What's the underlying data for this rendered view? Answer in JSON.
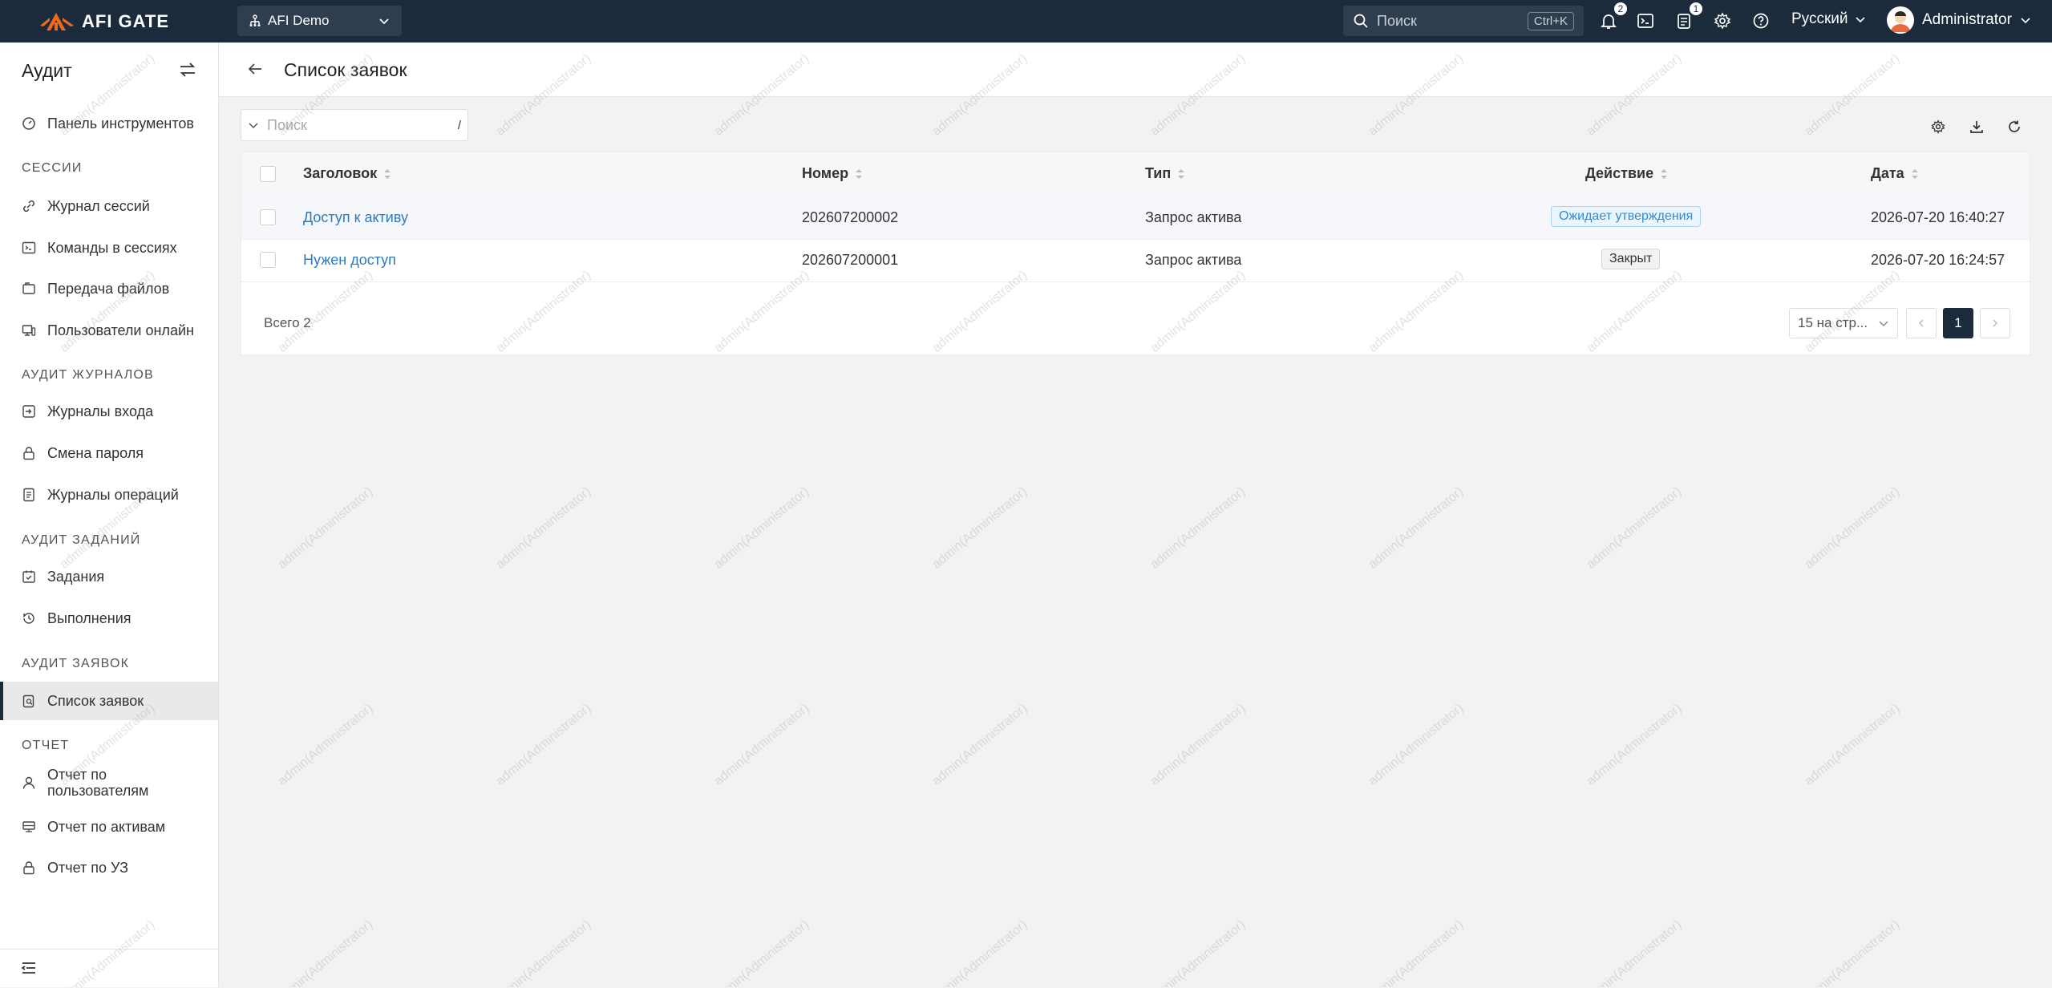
{
  "topbar": {
    "brand": "AFI GATE",
    "org": "AFI Demo",
    "search_placeholder": "Поиск",
    "search_shortcut": "Ctrl+K",
    "notifications_count": "2",
    "tasks_count": "1",
    "language": "Русский",
    "user": "Administrator"
  },
  "sidebar": {
    "title": "Аудит",
    "dashboard": "Панель инструментов",
    "sections": {
      "sessions": "СЕССИИ",
      "logs": "АУДИТ ЖУРНАЛОВ",
      "jobs": "АУДИТ ЗАДАНИЙ",
      "tickets": "АУДИТ ЗАЯВОК",
      "reports": "ОТЧЕТ"
    },
    "items": {
      "session_log": "Журнал сессий",
      "session_commands": "Команды в сессиях",
      "file_transfer": "Передача файлов",
      "online_users": "Пользователи онлайн",
      "login_logs": "Журналы входа",
      "password_change": "Смена пароля",
      "operation_logs": "Журналы операций",
      "jobs": "Задания",
      "executions": "Выполнения",
      "ticket_list": "Список заявок",
      "user_report_1": "Отчет по",
      "user_report_2": "пользователям",
      "asset_report": "Отчет по активам",
      "account_report": "Отчет по УЗ"
    }
  },
  "page": {
    "title": "Список заявок",
    "search_placeholder": "Поиск",
    "search_hint": "/"
  },
  "table": {
    "columns": [
      "Заголовок",
      "Номер",
      "Тип",
      "Действие",
      "Дата"
    ],
    "rows": [
      {
        "title": "Доступ к активу",
        "number": "202607200002",
        "type": "Запрос актива",
        "action": "Ожидает утверждения",
        "date": "2026-07-20 16:40:27"
      },
      {
        "title": "Нужен доступ",
        "number": "202607200001",
        "type": "Запрос актива",
        "action": "Закрыт",
        "date": "2026-07-20 16:24:57"
      }
    ],
    "total": "Всего 2",
    "page_size": "15 на стр...",
    "current_page": "1"
  },
  "watermark": "admin(Administrator)",
  "colors": {
    "topbar": "#1c2b3c",
    "link": "#2e7cbf",
    "pending_tag": "#2e8bd6",
    "logo_orange": "#ea6a1f"
  }
}
